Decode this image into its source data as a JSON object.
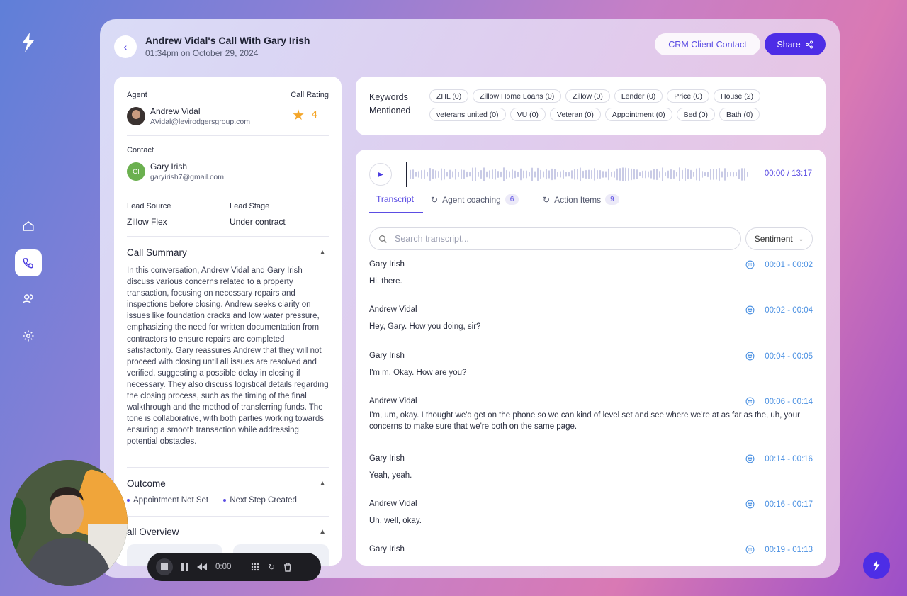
{
  "header": {
    "title": "Andrew Vidal's Call With Gary Irish",
    "subtitle": "01:34pm on October 29, 2024",
    "crm_button": "CRM Client Contact",
    "share_button": "Share"
  },
  "agent": {
    "label": "Agent",
    "name": "Andrew Vidal",
    "email": "AVidal@levirodgersgroup.com"
  },
  "call_rating": {
    "label": "Call Rating",
    "value": "4"
  },
  "contact": {
    "label": "Contact",
    "initials": "GI",
    "name": "Gary Irish",
    "email": "garyirish7@gmail.com"
  },
  "lead": {
    "source_label": "Lead Source",
    "source_value": "Zillow Flex",
    "stage_label": "Lead Stage",
    "stage_value": "Under contract"
  },
  "summary": {
    "title": "Call Summary",
    "text": "In this conversation, Andrew Vidal and Gary Irish discuss various concerns related to a property transaction, focusing on necessary repairs and inspections before closing. Andrew seeks clarity on issues like foundation cracks and low water pressure, emphasizing the need for written documentation from contractors to ensure repairs are completed satisfactorily. Gary reassures Andrew that they will not proceed with closing until all issues are resolved and verified, suggesting a possible delay in closing if necessary. They also discuss logistical details regarding the closing process, such as the timing of the final walkthrough and the method of transferring funds. The tone is collaborative, with both parties working towards ensuring a smooth transaction while addressing potential obstacles."
  },
  "outcome": {
    "title": "Outcome",
    "items": [
      "Appointment Not Set",
      "Next Step Created"
    ]
  },
  "overview": {
    "title": "all Overview"
  },
  "keywords": {
    "title": "Keywords Mentioned",
    "chips": [
      "ZHL (0)",
      "Zillow Home Loans (0)",
      "Zillow (0)",
      "Lender (0)",
      "Price (0)",
      "House (2)",
      "veterans united (0)",
      "VU (0)",
      "Veteran (0)",
      "Appointment (0)",
      "Bed (0)",
      "Bath (0)"
    ]
  },
  "player": {
    "time": "00:00 / 13:17"
  },
  "tabs": [
    {
      "label": "Transcript",
      "badge": ""
    },
    {
      "label": "Agent coaching",
      "badge": "6"
    },
    {
      "label": "Action Items",
      "badge": "9"
    }
  ],
  "search": {
    "placeholder": "Search transcript...",
    "sentiment_label": "Sentiment"
  },
  "transcript": [
    {
      "speaker": "Gary Irish",
      "time": "00:01 - 00:02",
      "text": "Hi, there."
    },
    {
      "speaker": "Andrew Vidal",
      "time": "00:02 - 00:04",
      "text": "Hey, Gary. How you doing, sir?"
    },
    {
      "speaker": "Gary Irish",
      "time": "00:04 - 00:05",
      "text": "I'm m. Okay. How are you?"
    },
    {
      "speaker": "Andrew Vidal",
      "time": "00:06 - 00:14",
      "text": "I'm, um, okay. I thought we'd get on the phone so we can kind of level set and see where we're at as far as the, uh, your concerns to make sure that we're both on the same page."
    },
    {
      "speaker": "Gary Irish",
      "time": "00:14 - 00:16",
      "text": "Yeah, yeah."
    },
    {
      "speaker": "Andrew Vidal",
      "time": "00:16 - 00:17",
      "text": "Uh, well, okay."
    },
    {
      "speaker": "Gary Irish",
      "time": "00:19 - 01:13",
      "text": ""
    }
  ],
  "recorder": {
    "time": "0:00"
  }
}
